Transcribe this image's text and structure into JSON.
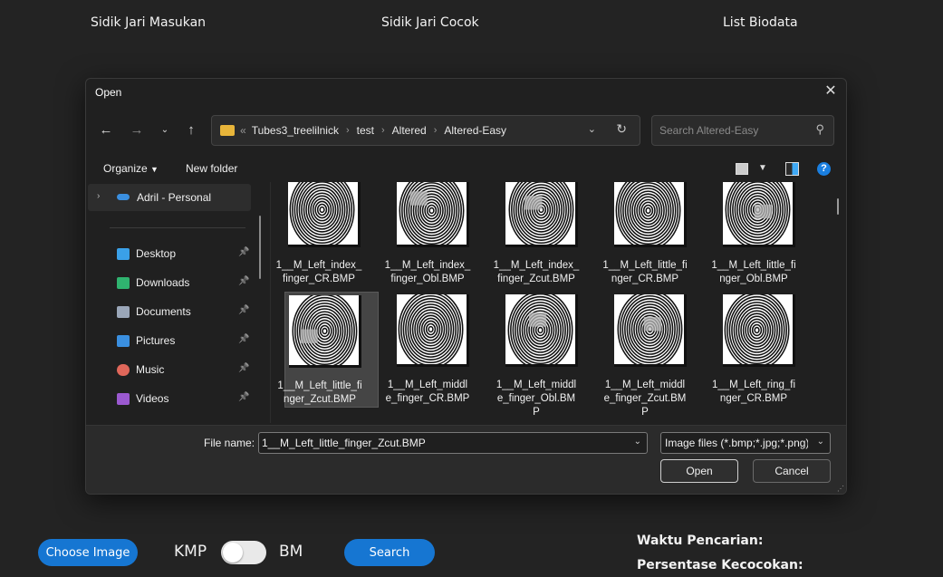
{
  "app": {
    "headers": [
      "Sidik Jari Masukan",
      "Sidik Jari Cocok",
      "List Biodata"
    ],
    "choose_image": "Choose Image",
    "kmp": "KMP",
    "bm": "BM",
    "search": "Search",
    "waktu": "Waktu Pencarian:",
    "persentase": "Persentase Kecocokan:"
  },
  "dialog": {
    "title": "Open",
    "breadcrumb": [
      "Tubes3_treelilnick",
      "test",
      "Altered",
      "Altered-Easy"
    ],
    "search_placeholder": "Search Altered-Easy",
    "organize": "Organize",
    "new_folder": "New folder",
    "sidebar": {
      "top": "Adril - Personal",
      "items": [
        {
          "label": "Desktop",
          "icon": "desktop-icon",
          "color": "#3aa0e8"
        },
        {
          "label": "Downloads",
          "icon": "download-icon",
          "color": "#2fb36f"
        },
        {
          "label": "Documents",
          "icon": "document-icon",
          "color": "#9aa6b8"
        },
        {
          "label": "Pictures",
          "icon": "pictures-icon",
          "color": "#3a8fe0"
        },
        {
          "label": "Music",
          "icon": "music-icon",
          "color": "#e0675a"
        },
        {
          "label": "Videos",
          "icon": "videos-icon",
          "color": "#9b59d0"
        }
      ]
    },
    "files": [
      [
        "1__M_Left_index_",
        "finger_CR.BMP",
        ""
      ],
      [
        "1__M_Left_index_",
        "finger_Obl.BMP",
        ""
      ],
      [
        "1__M_Left_index_",
        "finger_Zcut.BMP",
        ""
      ],
      [
        "1__M_Left_little_fi",
        "nger_CR.BMP",
        ""
      ],
      [
        "1__M_Left_little_fi",
        "nger_Obl.BMP",
        ""
      ],
      [
        "1__M_Left_little_fi",
        "nger_Zcut.BMP",
        ""
      ],
      [
        "1__M_Left_middl",
        "e_finger_CR.BMP",
        ""
      ],
      [
        "1__M_Left_middl",
        "e_finger_Obl.BM",
        "P"
      ],
      [
        "1__M_Left_middl",
        "e_finger_Zcut.BM",
        "P"
      ],
      [
        "1__M_Left_ring_fi",
        "nger_CR.BMP",
        ""
      ]
    ],
    "selected_index": 5,
    "file_name_label": "File name:",
    "file_name_value": "1__M_Left_little_finger_Zcut.BMP",
    "file_type": "Image files  (*.bmp;*.jpg;*.png)",
    "open": "Open",
    "cancel": "Cancel"
  }
}
